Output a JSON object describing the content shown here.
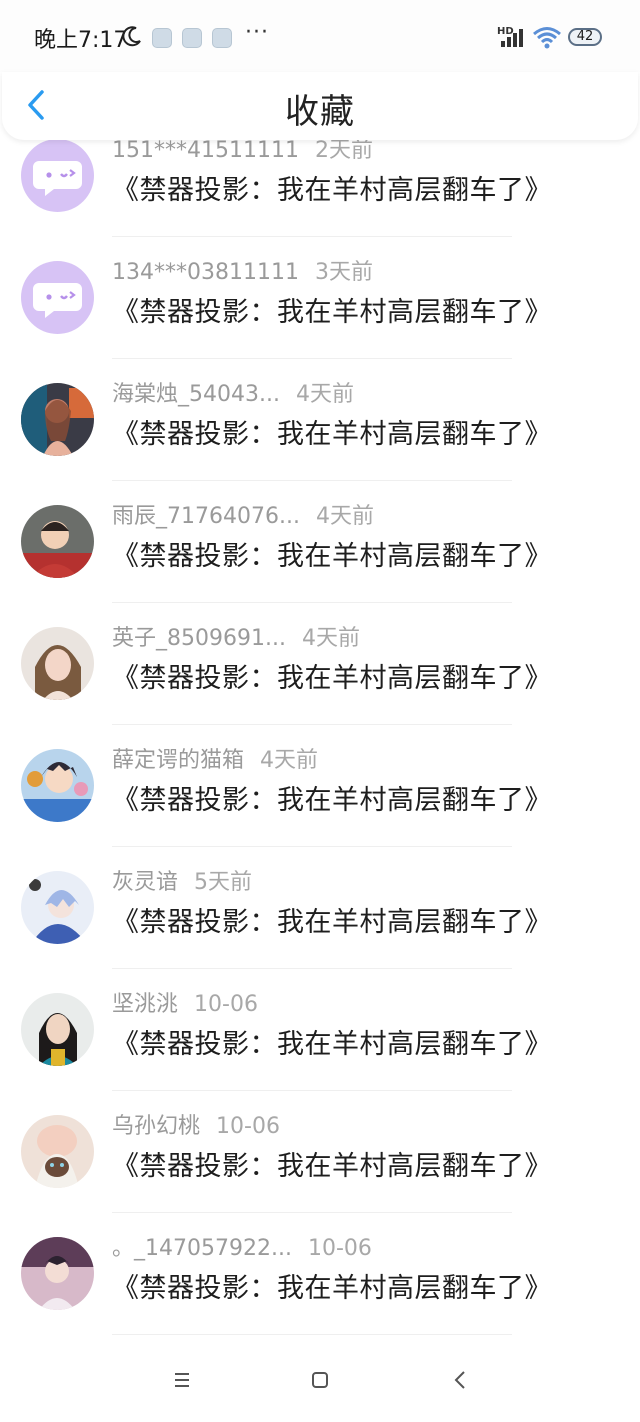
{
  "status_bar": {
    "time": "晚上7:17",
    "more_dots": "···",
    "hd_label": "HD",
    "battery": "42"
  },
  "header": {
    "title": "收藏"
  },
  "items": [
    {
      "user": "151***41511111",
      "time": "2天前",
      "title": "《禁器投影：我在羊村高层翻车了》",
      "avatar": "default"
    },
    {
      "user": "134***03811111",
      "time": "3天前",
      "title": "《禁器投影：我在羊村高层翻车了》",
      "avatar": "default"
    },
    {
      "user": "海棠烛_54043...",
      "time": "4天前",
      "title": "《禁器投影：我在羊村高层翻车了》",
      "avatar": "photo-1"
    },
    {
      "user": "雨辰_71764076...",
      "time": "4天前",
      "title": "《禁器投影：我在羊村高层翻车了》",
      "avatar": "photo-2"
    },
    {
      "user": "英子_8509691...",
      "time": "4天前",
      "title": "《禁器投影：我在羊村高层翻车了》",
      "avatar": "photo-3"
    },
    {
      "user": "薛定谔的猫箱",
      "time": "4天前",
      "title": "《禁器投影：我在羊村高层翻车了》",
      "avatar": "anime-1"
    },
    {
      "user": "灰灵谙",
      "time": "5天前",
      "title": "《禁器投影：我在羊村高层翻车了》",
      "avatar": "anime-2"
    },
    {
      "user": "坚洮洮",
      "time": "10-06",
      "title": "《禁器投影：我在羊村高层翻车了》",
      "avatar": "photo-4"
    },
    {
      "user": "乌孙幻桃",
      "time": "10-06",
      "title": "《禁器投影：我在羊村高层翻车了》",
      "avatar": "photo-5"
    },
    {
      "user": "。_147057922...",
      "time": "10-06",
      "title": "《禁器投影：我在羊村高层翻车了》",
      "avatar": "anime-3"
    }
  ],
  "nav": {
    "icons": [
      "menu-icon",
      "home-icon",
      "back-icon"
    ]
  },
  "colors": {
    "accent": "#2a9bf0",
    "default_avatar_bg": "#d7c3f5",
    "meta_text": "#9a9a9a",
    "title_text": "#1e1e1e"
  }
}
